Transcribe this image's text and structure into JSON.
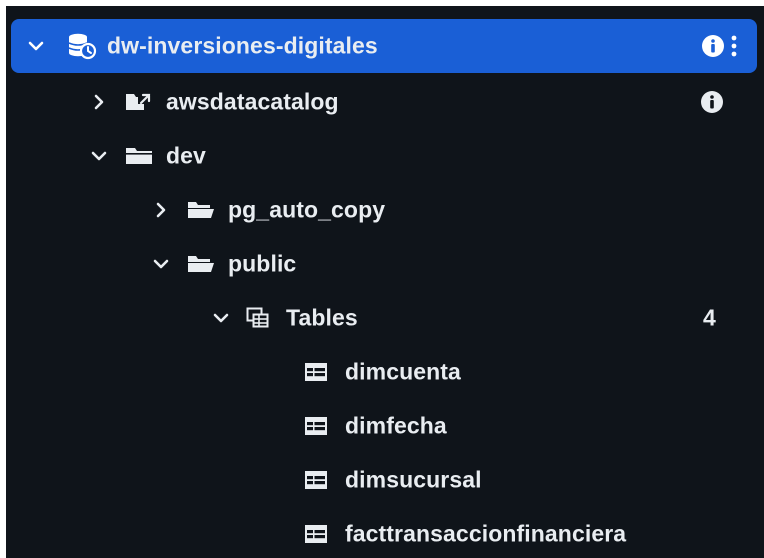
{
  "tree": {
    "root": {
      "label": "dw-inversiones-digitales",
      "expanded": true,
      "icon": "redshift-database-icon"
    },
    "awsdatacatalog": {
      "label": "awsdatacatalog",
      "expanded": false,
      "icon": "catalog-icon"
    },
    "dev": {
      "label": "dev",
      "expanded": true,
      "icon": "folder-icon"
    },
    "pg_auto_copy": {
      "label": "pg_auto_copy",
      "expanded": false,
      "icon": "schema-folder-icon"
    },
    "public": {
      "label": "public",
      "expanded": true,
      "icon": "schema-folder-icon"
    },
    "tables": {
      "label": "Tables",
      "count": "4",
      "expanded": true,
      "icon": "tables-icon"
    },
    "table_items": [
      {
        "label": "dimcuenta"
      },
      {
        "label": "dimfecha"
      },
      {
        "label": "dimsucursal"
      },
      {
        "label": "facttransaccionfinanciera"
      }
    ]
  },
  "colors": {
    "background": "#0f141a",
    "selected": "#1a5fd6",
    "text": "#e9edf1"
  }
}
